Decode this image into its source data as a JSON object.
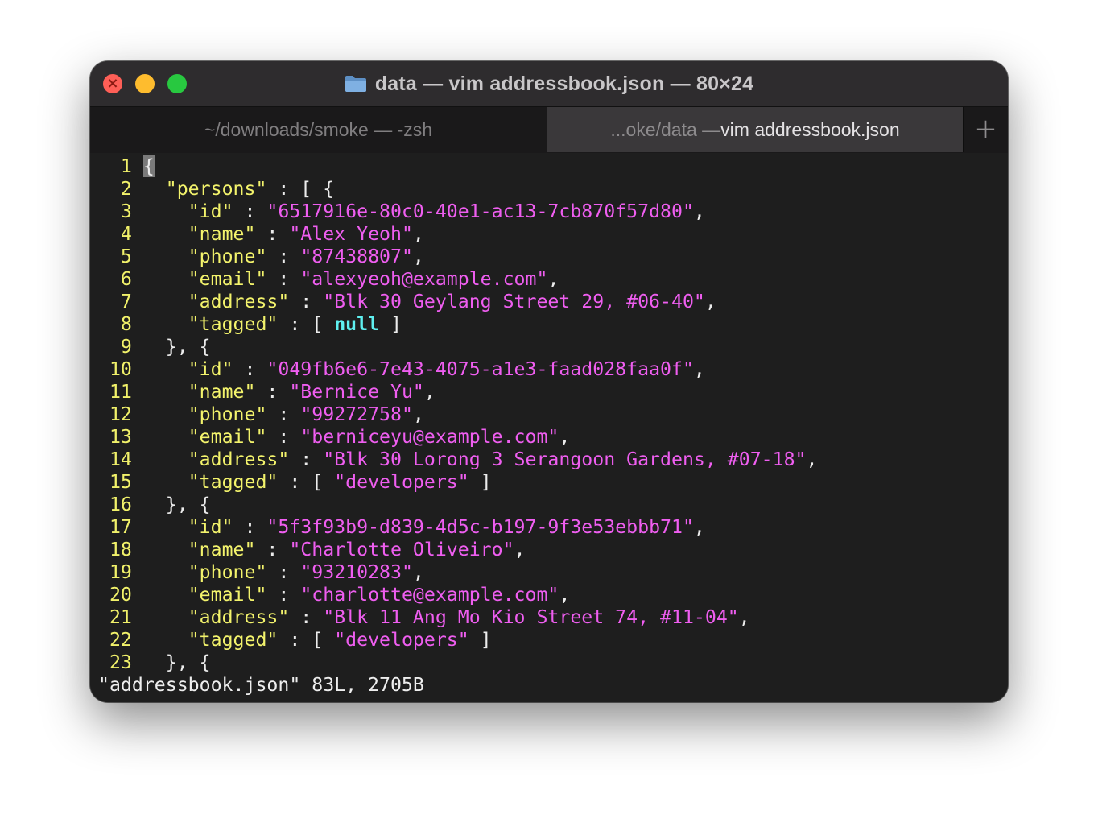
{
  "window": {
    "title": "data — vim addressbook.json — 80×24",
    "traffic_lights": {
      "close": "#fe5f57",
      "minimize": "#febc2e",
      "zoom": "#28c840"
    },
    "icon": "folder-icon"
  },
  "tabs": [
    {
      "label": "~/downloads/smoke — -zsh",
      "active": false
    },
    {
      "prefix": "...oke/data — ",
      "label": "vim addressbook.json",
      "active": true
    }
  ],
  "new_tab_label": "+",
  "colors": {
    "line_number": "#f1f16a",
    "key": "#f3f36c",
    "string": "#ef5ef0",
    "null": "#5ff0f0",
    "background": "#1e1e1e"
  },
  "editor": {
    "lines": [
      {
        "n": "1",
        "tokens": [
          [
            "cursor",
            "{"
          ]
        ]
      },
      {
        "n": "2",
        "tokens": [
          [
            "punct",
            "  "
          ],
          [
            "key",
            "\"persons\""
          ],
          [
            "punct",
            " : [ {"
          ]
        ]
      },
      {
        "n": "3",
        "tokens": [
          [
            "punct",
            "    "
          ],
          [
            "key",
            "\"id\""
          ],
          [
            "punct",
            " : "
          ],
          [
            "str",
            "\"6517916e-80c0-40e1-ac13-7cb870f57d80\""
          ],
          [
            "punct",
            ","
          ]
        ]
      },
      {
        "n": "4",
        "tokens": [
          [
            "punct",
            "    "
          ],
          [
            "key",
            "\"name\""
          ],
          [
            "punct",
            " : "
          ],
          [
            "str",
            "\"Alex Yeoh\""
          ],
          [
            "punct",
            ","
          ]
        ]
      },
      {
        "n": "5",
        "tokens": [
          [
            "punct",
            "    "
          ],
          [
            "key",
            "\"phone\""
          ],
          [
            "punct",
            " : "
          ],
          [
            "str",
            "\"87438807\""
          ],
          [
            "punct",
            ","
          ]
        ]
      },
      {
        "n": "6",
        "tokens": [
          [
            "punct",
            "    "
          ],
          [
            "key",
            "\"email\""
          ],
          [
            "punct",
            " : "
          ],
          [
            "str",
            "\"alexyeoh@example.com\""
          ],
          [
            "punct",
            ","
          ]
        ]
      },
      {
        "n": "7",
        "tokens": [
          [
            "punct",
            "    "
          ],
          [
            "key",
            "\"address\""
          ],
          [
            "punct",
            " : "
          ],
          [
            "str",
            "\"Blk 30 Geylang Street 29, #06-40\""
          ],
          [
            "punct",
            ","
          ]
        ]
      },
      {
        "n": "8",
        "tokens": [
          [
            "punct",
            "    "
          ],
          [
            "key",
            "\"tagged\""
          ],
          [
            "punct",
            " : [ "
          ],
          [
            "null",
            "null"
          ],
          [
            "punct",
            " ]"
          ]
        ]
      },
      {
        "n": "9",
        "tokens": [
          [
            "punct",
            "  }, {"
          ]
        ]
      },
      {
        "n": "10",
        "tokens": [
          [
            "punct",
            "    "
          ],
          [
            "key",
            "\"id\""
          ],
          [
            "punct",
            " : "
          ],
          [
            "str",
            "\"049fb6e6-7e43-4075-a1e3-faad028faa0f\""
          ],
          [
            "punct",
            ","
          ]
        ]
      },
      {
        "n": "11",
        "tokens": [
          [
            "punct",
            "    "
          ],
          [
            "key",
            "\"name\""
          ],
          [
            "punct",
            " : "
          ],
          [
            "str",
            "\"Bernice Yu\""
          ],
          [
            "punct",
            ","
          ]
        ]
      },
      {
        "n": "12",
        "tokens": [
          [
            "punct",
            "    "
          ],
          [
            "key",
            "\"phone\""
          ],
          [
            "punct",
            " : "
          ],
          [
            "str",
            "\"99272758\""
          ],
          [
            "punct",
            ","
          ]
        ]
      },
      {
        "n": "13",
        "tokens": [
          [
            "punct",
            "    "
          ],
          [
            "key",
            "\"email\""
          ],
          [
            "punct",
            " : "
          ],
          [
            "str",
            "\"berniceyu@example.com\""
          ],
          [
            "punct",
            ","
          ]
        ]
      },
      {
        "n": "14",
        "tokens": [
          [
            "punct",
            "    "
          ],
          [
            "key",
            "\"address\""
          ],
          [
            "punct",
            " : "
          ],
          [
            "str",
            "\"Blk 30 Lorong 3 Serangoon Gardens, #07-18\""
          ],
          [
            "punct",
            ","
          ]
        ]
      },
      {
        "n": "15",
        "tokens": [
          [
            "punct",
            "    "
          ],
          [
            "key",
            "\"tagged\""
          ],
          [
            "punct",
            " : [ "
          ],
          [
            "str",
            "\"developers\""
          ],
          [
            "punct",
            " ]"
          ]
        ]
      },
      {
        "n": "16",
        "tokens": [
          [
            "punct",
            "  }, {"
          ]
        ]
      },
      {
        "n": "17",
        "tokens": [
          [
            "punct",
            "    "
          ],
          [
            "key",
            "\"id\""
          ],
          [
            "punct",
            " : "
          ],
          [
            "str",
            "\"5f3f93b9-d839-4d5c-b197-9f3e53ebbb71\""
          ],
          [
            "punct",
            ","
          ]
        ]
      },
      {
        "n": "18",
        "tokens": [
          [
            "punct",
            "    "
          ],
          [
            "key",
            "\"name\""
          ],
          [
            "punct",
            " : "
          ],
          [
            "str",
            "\"Charlotte Oliveiro\""
          ],
          [
            "punct",
            ","
          ]
        ]
      },
      {
        "n": "19",
        "tokens": [
          [
            "punct",
            "    "
          ],
          [
            "key",
            "\"phone\""
          ],
          [
            "punct",
            " : "
          ],
          [
            "str",
            "\"93210283\""
          ],
          [
            "punct",
            ","
          ]
        ]
      },
      {
        "n": "20",
        "tokens": [
          [
            "punct",
            "    "
          ],
          [
            "key",
            "\"email\""
          ],
          [
            "punct",
            " : "
          ],
          [
            "str",
            "\"charlotte@example.com\""
          ],
          [
            "punct",
            ","
          ]
        ]
      },
      {
        "n": "21",
        "tokens": [
          [
            "punct",
            "    "
          ],
          [
            "key",
            "\"address\""
          ],
          [
            "punct",
            " : "
          ],
          [
            "str",
            "\"Blk 11 Ang Mo Kio Street 74, #11-04\""
          ],
          [
            "punct",
            ","
          ]
        ]
      },
      {
        "n": "22",
        "tokens": [
          [
            "punct",
            "    "
          ],
          [
            "key",
            "\"tagged\""
          ],
          [
            "punct",
            " : [ "
          ],
          [
            "str",
            "\"developers\""
          ],
          [
            "punct",
            " ]"
          ]
        ]
      },
      {
        "n": "23",
        "tokens": [
          [
            "punct",
            "  }, {"
          ]
        ]
      }
    ],
    "status_line": "\"addressbook.json\" 83L, 2705B"
  }
}
